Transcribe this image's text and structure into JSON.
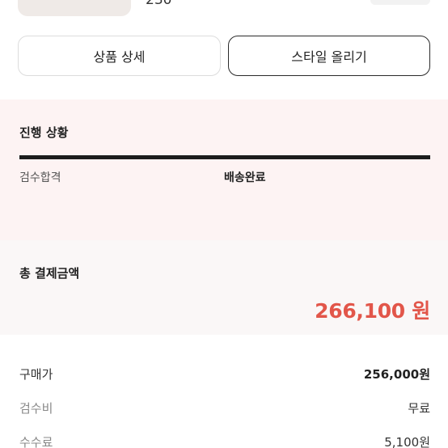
{
  "header_partial": {
    "cut_text": "230"
  },
  "actions": {
    "product_detail_label": "상품 상세",
    "post_style_label": "스타일 올리기"
  },
  "progress": {
    "title": "진행 상황",
    "steps": [
      {
        "label": "검수합격",
        "active": false
      },
      {
        "label": "배송완료",
        "active": true
      }
    ]
  },
  "total": {
    "label": "총 결제금액",
    "amount": "266,100 원",
    "accent_color": "#e2564a"
  },
  "breakdown": {
    "rows": [
      {
        "label": "구매가",
        "value": "256,000원"
      },
      {
        "label": "검수비",
        "value": "무료"
      },
      {
        "label": "수수료",
        "value": "5,100원"
      }
    ]
  }
}
